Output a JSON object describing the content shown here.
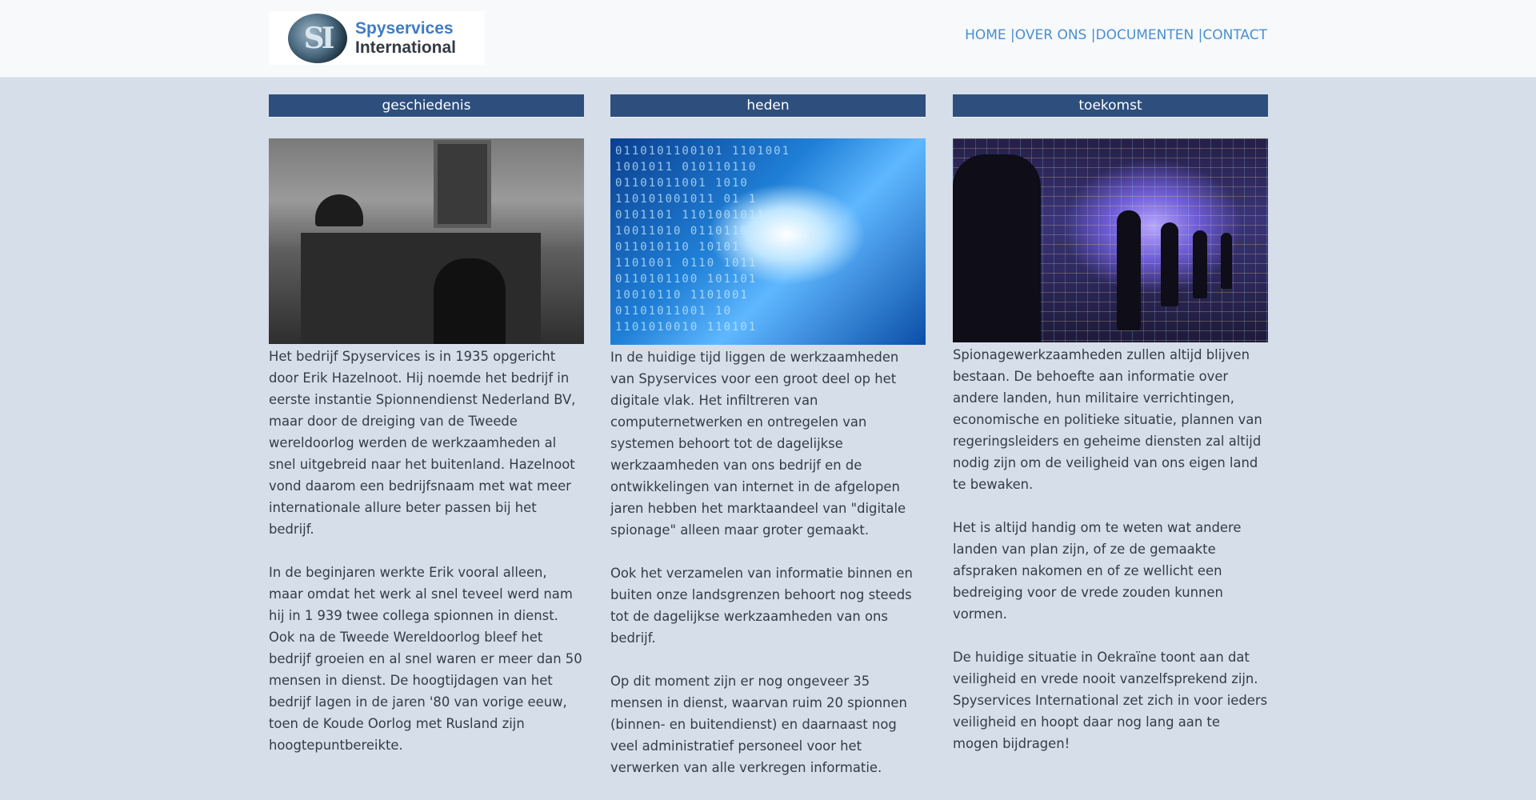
{
  "header": {
    "logo": {
      "line1": "Spyservices",
      "line2": "International",
      "emblem": "SI"
    },
    "nav": [
      {
        "label": "HOME |"
      },
      {
        "label": "OVER ONS |"
      },
      {
        "label": "DOCUMENTEN |"
      },
      {
        "label": "CONTACT"
      }
    ]
  },
  "columns": [
    {
      "heading": "geschiedenis",
      "image": "office-desk-photo",
      "paragraphs": [
        "Het bedrijf Spyservices is in 1935 opgericht door Erik Hazelnoot. Hij noemde het bedrijf in eerste instantie Spionnendienst Nederland BV, maar door de dreiging van de Tweede wereldoorlog werden de werkzaamheden al snel uitgebreid naar het buitenland. Hazelnoot vond daarom een bedrijfsnaam met wat meer internationale allure beter passen bij het bedrijf.",
        "In de beginjaren werkte Erik vooral alleen, maar omdat het werk al snel teveel werd nam hij in 1 939 twee collega spionnen in dienst. Ook na de Tweede Wereldoorlog bleef het bedrijf groeien en al snel waren er meer dan 50 mensen in dienst. De hoogtijdagen van het bedrijf lagen in de jaren '80 van vorige eeuw, toen de Koude Oorlog met Rusland zijn hoogtepuntbereikte."
      ]
    },
    {
      "heading": "heden",
      "image": "digital-binary-photo",
      "paragraphs": [
        "In de huidige tijd liggen de werkzaamheden van Spyservices voor een groot deel op het digitale vlak. Het infiltreren van computernetwerken en ontregelen van systemen behoort tot de dagelijkse werkzaamheden van ons bedrijf en de ontwikkelingen van internet in de afgelopen jaren hebben het marktaandeel van \"digitale spionage\" alleen maar groter gemaakt.",
        "Ook het verzamelen van informatie binnen en buiten onze landsgrenzen behoort nog steeds tot de dagelijkse werkzaamheden van ons bedrijf.",
        "Op dit moment zijn er nog ongeveer 35 mensen in dienst, waarvan ruim 20 spionnen (binnen- en buitendienst) en daarnaast nog veel administratief personeel voor het verwerken van alle verkregen informatie."
      ]
    },
    {
      "heading": "toekomst",
      "image": "futuristic-data-room-photo",
      "paragraphs": [
        "Spionagewerkzaamheden zullen altijd blijven bestaan. De behoefte aan informatie over andere landen, hun militaire verrichtingen, economische en politieke situatie, plannen van regeringsleiders en geheime diensten zal altijd nodig zijn om de veiligheid van ons eigen land te bewaken.",
        "Het is altijd handig om te weten wat andere landen van plan zijn, of ze de gemaakte afspraken nakomen en of ze wellicht een bedreiging voor de vrede zouden kunnen vormen.",
        "De huidige situatie in Oekraïne toont aan dat veiligheid en vrede nooit vanzelfsprekend zijn. Spyservices International zet zich in voor ieders veiligheid en hoopt daar nog lang aan te mogen bijdragen!"
      ]
    }
  ]
}
